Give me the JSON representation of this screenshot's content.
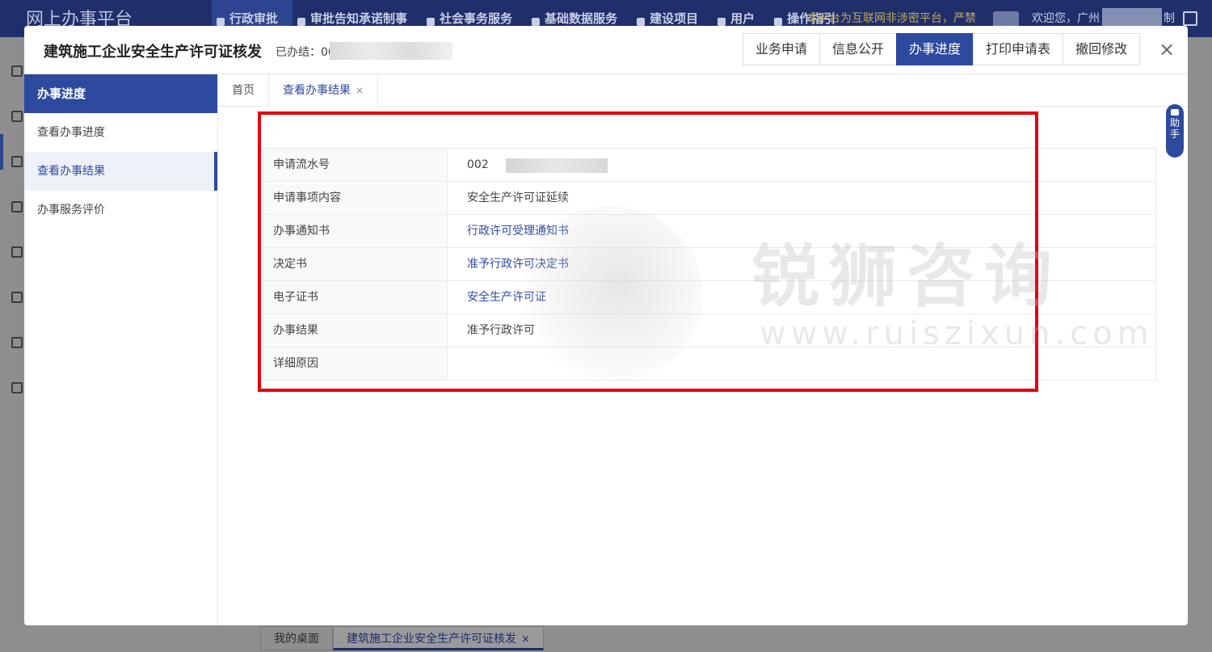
{
  "app": {
    "logo": "网上办事平台",
    "nav": [
      "行政审批",
      "审批告知承诺制事",
      "社会事务服务",
      "基础数据服务",
      "建设项目",
      "用户",
      "操作指引"
    ],
    "notice": "本平台为互联网非涉密平台，严禁",
    "welcome": "欢迎您，广州",
    "welcome_tail": "制"
  },
  "bottom_tabs": [
    {
      "label": "我的桌面"
    },
    {
      "label": "建筑施工企业安全生产许可证核发",
      "close": "×"
    }
  ],
  "modal": {
    "title": "建筑施工企业安全生产许可证核发",
    "done_label": "已办结：00",
    "head_buttons": [
      "业务申请",
      "信息公开",
      "办事进度",
      "打印申请表",
      "撤回修改"
    ],
    "close": "×",
    "sidebar": {
      "header": "办事进度",
      "items": [
        "查看办事进度",
        "查看办事结果",
        "办事服务评价"
      ]
    },
    "tabs": [
      {
        "label": "首页"
      },
      {
        "label": "查看办事结果",
        "close": "×"
      }
    ],
    "helper": "助手",
    "result_rows": [
      {
        "key": "申请流水号",
        "value": "002"
      },
      {
        "key": "申请事项内容",
        "value": "安全生产许可证延续"
      },
      {
        "key": "办事通知书",
        "value": "行政许可受理通知书"
      },
      {
        "key": "决定书",
        "value": "准予行政许可决定书"
      },
      {
        "key": "电子证书",
        "value": "安全生产许可证"
      },
      {
        "key": "办事结果",
        "value": "准予行政许可"
      },
      {
        "key": "详细原因",
        "value": ""
      }
    ]
  },
  "watermark": {
    "cn": "锐狮咨询",
    "url": "www.ruiszixun.com"
  },
  "colors": {
    "primary": "#2e4a9e",
    "highlight": "#e6000f",
    "header_bg": "#1e2f6b"
  }
}
